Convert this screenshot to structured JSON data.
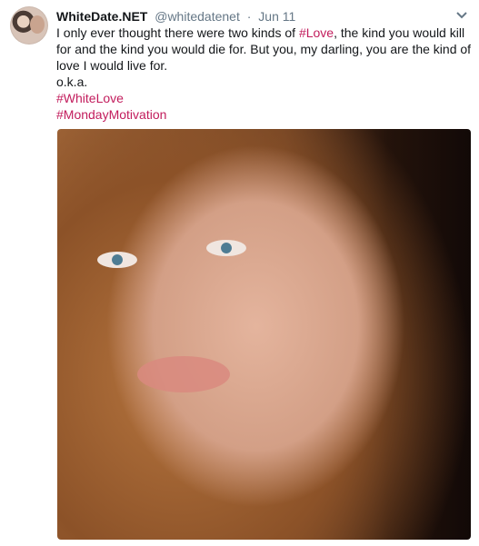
{
  "author": {
    "display_name": "WhiteDate.NET",
    "handle": "@whitedatenet",
    "separator": "·",
    "date": "Jun 11"
  },
  "tweet": {
    "body": [
      {
        "text": "I only ever thought there were two kinds of "
      },
      {
        "text": "#Love",
        "hashtag": true
      },
      {
        "text": ", the kind you would kill for and the kind you would die for. But you, my darling, you are the kind of love I would live for."
      }
    ],
    "signature": "o.k.a.",
    "hashtags": [
      "#WhiteLove",
      "#MondayMotivation"
    ]
  },
  "colors": {
    "hashtag": "#c21c5c",
    "meta_text": "#657786",
    "primary_text": "#14171a"
  },
  "icons": {
    "menu": "chevron-down-icon"
  }
}
